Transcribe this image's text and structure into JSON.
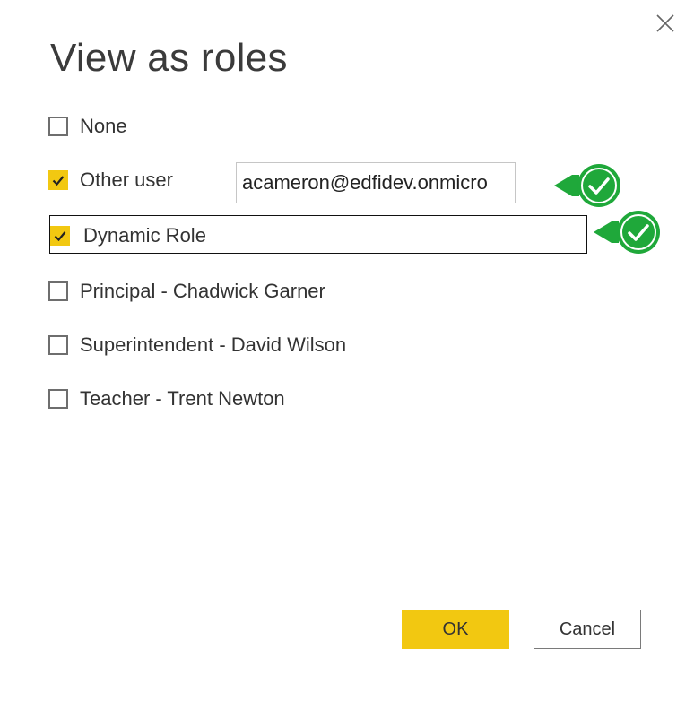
{
  "dialog": {
    "title": "View as roles",
    "close_icon": "close-icon"
  },
  "options": [
    {
      "label": "None",
      "checked": false
    },
    {
      "label": "Other user",
      "checked": true
    },
    {
      "label": "Dynamic Role",
      "checked": true
    },
    {
      "label": "Principal - Chadwick Garner",
      "checked": false
    },
    {
      "label": "Superintendent - David Wilson",
      "checked": false
    },
    {
      "label": "Teacher - Trent Newton",
      "checked": false
    }
  ],
  "other_user": {
    "value": "acameron@edfidev.onmicro"
  },
  "badges": {
    "icon": "green-checkmark-pointer-icon",
    "color": "#1fa83a"
  },
  "buttons": {
    "ok_label": "OK",
    "cancel_label": "Cancel"
  },
  "colors": {
    "accent": "#f2c811"
  }
}
